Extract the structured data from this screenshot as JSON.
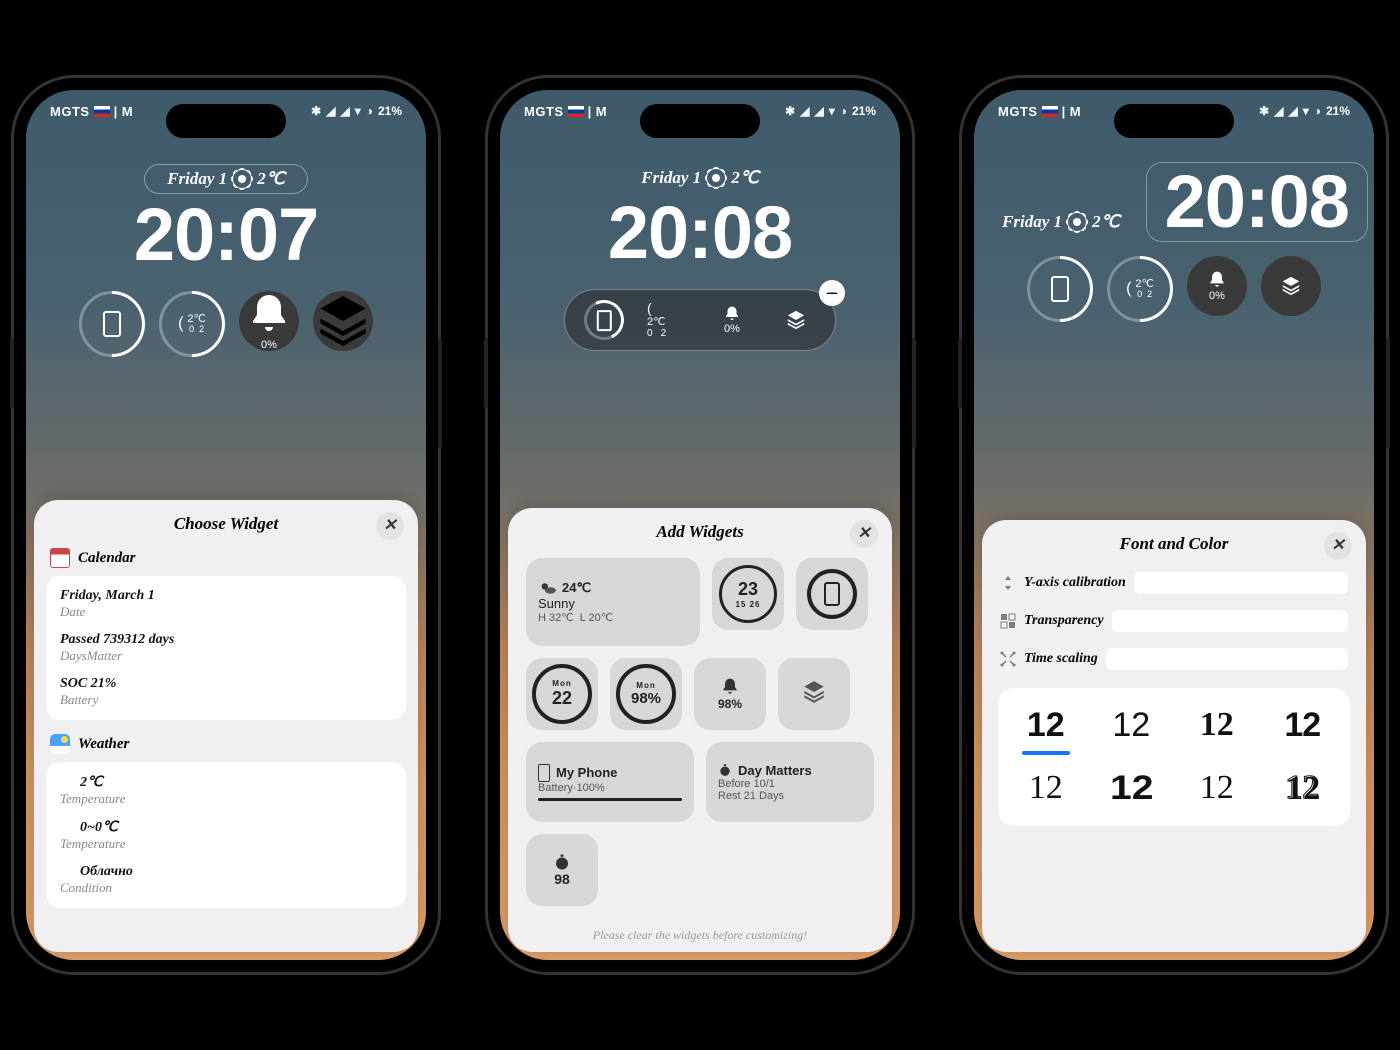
{
  "status": {
    "carrier_left": "MGTS",
    "carrier_right": "| M",
    "battery": "21%"
  },
  "phone1": {
    "date": "Friday 1",
    "temp": "2℃",
    "time": "20:07",
    "chips": {
      "temp": "2℃",
      "low": "0",
      "hi": "2",
      "alarm": "0%"
    },
    "sheet": {
      "title": "Choose Widget",
      "sections": [
        {
          "title": "Calendar",
          "rows": [
            {
              "t1": "Friday, March 1",
              "t2": "Date"
            },
            {
              "t1": "Passed 739312 days",
              "t2": "DaysMatter"
            },
            {
              "t1": "SOC 21%",
              "t2": "Battery"
            }
          ]
        },
        {
          "title": "Weather",
          "rows": [
            {
              "t1": "2℃",
              "t2": "Temperature"
            },
            {
              "t1": "0~0℃",
              "t2": "Temperature"
            },
            {
              "t1": "Облачно",
              "t2": "Condition"
            }
          ]
        }
      ]
    }
  },
  "phone2": {
    "date": "Friday 1",
    "temp": "2℃",
    "time": "20:08",
    "chips": {
      "temp": "2℃",
      "low": "0",
      "hi": "2",
      "alarm": "0%"
    },
    "sheet": {
      "title": "Add Widgets",
      "hint": "Please clear the widgets before customizing!",
      "tiles": {
        "weather": {
          "temp": "24℃",
          "cond": "Sunny",
          "hi": "H 32℃",
          "lo": "L 20℃"
        },
        "ring1": {
          "big": "23",
          "sm": "15  26"
        },
        "monDate": {
          "day": "Mon",
          "num": "22"
        },
        "monPct": {
          "day": "Mon",
          "num": "98%"
        },
        "bellPct": "98%",
        "myphone": {
          "title": "My Phone",
          "sub": "Battery·100%"
        },
        "daymatters": {
          "title": "Day Matters",
          "l1": "Before 10/1",
          "l2": "Rest 21 Days"
        },
        "timer": "98"
      }
    }
  },
  "phone3": {
    "date": "Friday 1",
    "temp": "2℃",
    "time": "20:08",
    "chips": {
      "temp": "2℃",
      "low": "0",
      "hi": "2",
      "alarm": "0%"
    },
    "sheet": {
      "title": "Font and Color",
      "controls": [
        "Y-axis calibration",
        "Transparency",
        "Time scaling"
      ],
      "sample": "12"
    }
  }
}
